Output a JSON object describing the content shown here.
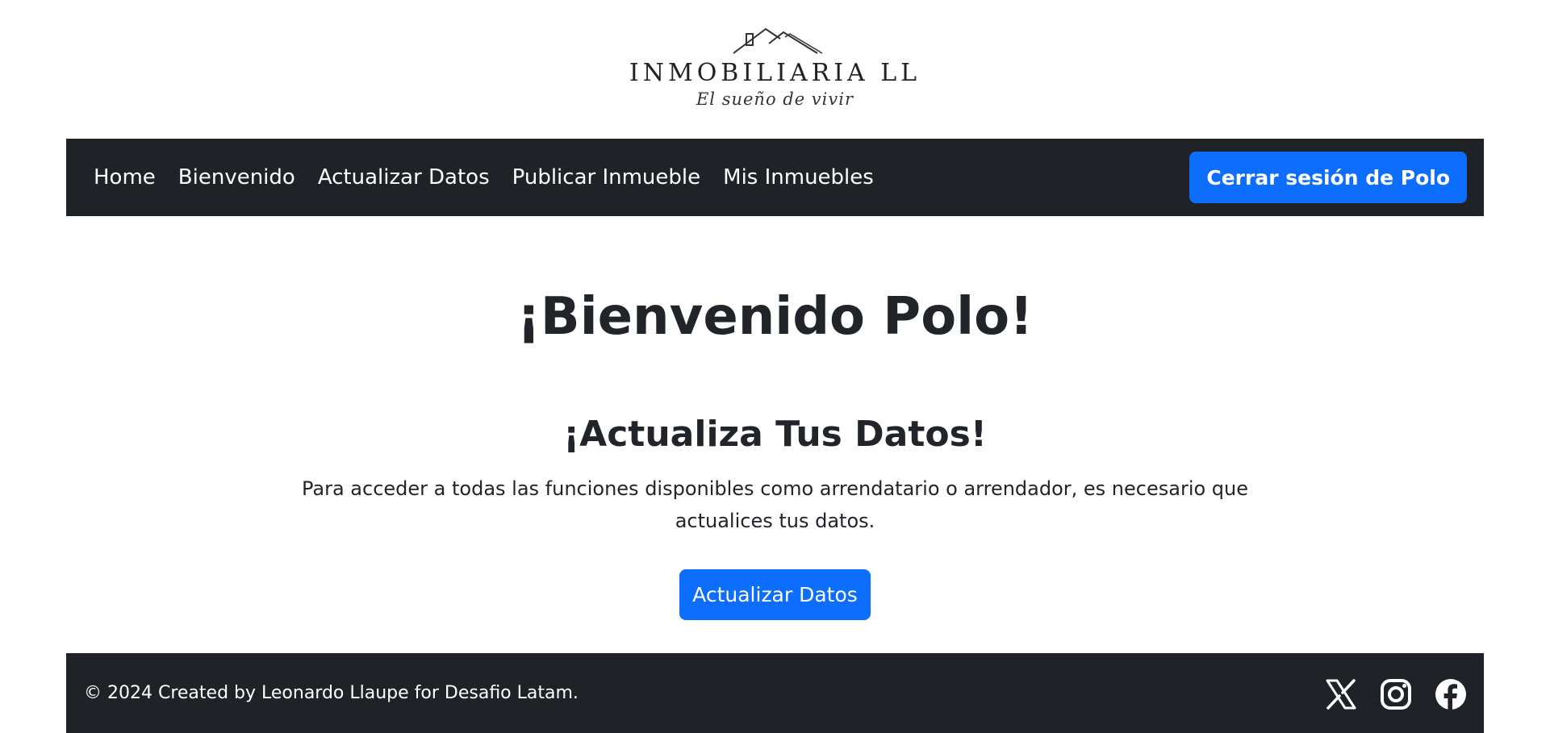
{
  "logo": {
    "name": "INMOBILIARIA LL",
    "tagline": "El sueño de vivir"
  },
  "navbar": {
    "links": [
      {
        "label": "Home"
      },
      {
        "label": "Bienvenido"
      },
      {
        "label": "Actualizar Datos"
      },
      {
        "label": "Publicar Inmueble"
      },
      {
        "label": "Mis Inmuebles"
      }
    ],
    "logout_label": "Cerrar sesión de Polo"
  },
  "main": {
    "welcome_title": "¡Bienvenido Polo!",
    "update_title": "¡Actualiza Tus Datos!",
    "update_text": "Para acceder a todas las funciones disponibles como arrendatario o arrendador, es necesario que actualices tus datos.",
    "update_button": "Actualizar Datos"
  },
  "footer": {
    "text": "© 2024 Created by Leonardo Llaupe for Desafio Latam.",
    "social_icons": [
      "x-icon",
      "instagram-icon",
      "facebook-icon"
    ]
  },
  "colors": {
    "navbar_bg": "#1f2328",
    "primary": "#0d6efd",
    "text": "#212529"
  }
}
